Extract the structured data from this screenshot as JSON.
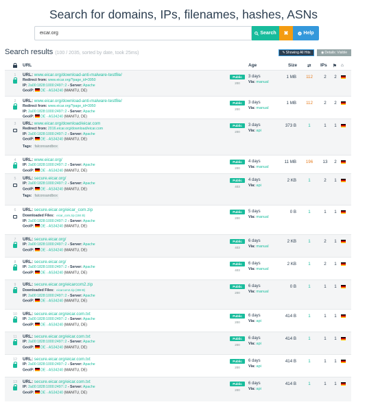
{
  "title": "Search for domains, IPs, filenames, hashes, ASNs",
  "search": {
    "value": "eicar.org",
    "search_label": "Search",
    "clear_label": "✖",
    "help_label": "Help"
  },
  "results": {
    "heading": "Search results",
    "meta": "(100 / 2035, sorted by date, took 25ms)",
    "show_hits_label": "Showing All Hits",
    "details_label": "Details: Visible"
  },
  "columns": {
    "url": "URL",
    "age": "Age",
    "size": "Size",
    "ips": "IPs"
  },
  "labels": {
    "url": "URL:",
    "redirect": "Redirect from:",
    "ip": "IP:",
    "server": "- Server:",
    "geoip": "GeoIP:",
    "tags": "Tags:",
    "downloaded": "Downloaded Files:",
    "via": "Via:"
  },
  "rows": [
    {
      "idx": "1",
      "lock": "green",
      "url": "www.eicar.org/download-anti-malware-testfile/",
      "redirect": "www.eicar.org/?page_id=3950",
      "ip": "2a00:1828:1000:2497::2",
      "server": "Apache",
      "geo": "DE - AS34240",
      "asn": "(MANITU, DE)",
      "status": "Public",
      "code": "200",
      "age": "3 days",
      "via": "manual",
      "size": "1 MB",
      "n1": "112",
      "n1_color": "orange",
      "n2": "2",
      "n3": "2"
    },
    {
      "idx": "2",
      "lock": "green",
      "url": "www.eicar.org/download-anti-malware-testfile/",
      "redirect": "www.eicar.org/?page_id=3950",
      "ip": "2a00:1828:1000:2497::2",
      "server": "Apache",
      "geo": "DE - AS34240",
      "asn": "(MANITU, DE)",
      "status": "Public",
      "code": "200",
      "age": "3 days",
      "via": "manual",
      "size": "1 MB",
      "n1": "112",
      "n1_color": "orange",
      "n2": "2",
      "n3": "2"
    },
    {
      "idx": "3",
      "lock": "grey",
      "url": "www.eicar.org/download/eicar.com",
      "redirect": "2016.eicar.org/download/eicar.com",
      "ip": "2a00:1828:1000:2497::2",
      "server": "Apache",
      "geo": "DE - AS34240",
      "asn": "(MANITU, DE)",
      "tags": "falconsandbox",
      "status": "Public",
      "code": "200",
      "age": "3 days",
      "via": "api",
      "size": "373 B",
      "n1": "1",
      "n1_color": "teal",
      "n2": "1",
      "n3": "1"
    },
    {
      "idx": "4",
      "lock": "green",
      "url": "www.eicar.org/",
      "ip": "2a00:1828:1000:2497::2",
      "server": "Apache",
      "geo": "DE - AS34240",
      "asn": "(MANITU, DE)",
      "status": "Public",
      "code": "200",
      "age": "4 days",
      "via": "manual",
      "size": "11 MB",
      "n1": "196",
      "n1_color": "orange",
      "n2": "13",
      "n3": "2"
    },
    {
      "idx": "5",
      "lock": "grey",
      "url": "secure.eicar.org/",
      "ip": "2a00:1828:1000:2497::2",
      "server": "Apache",
      "geo": "DE - AS34240",
      "asn": "(MANITU, DE)",
      "tags": "falconsandbox",
      "status": "Public",
      "code": "403",
      "age": "4 days",
      "via": "api",
      "size": "2 KB",
      "n1": "1",
      "n1_color": "teal",
      "n2": "2",
      "n3": "1"
    },
    {
      "idx": "6",
      "lock": "grey",
      "url": "secure.eicar.org/eicar_com.zip",
      "dl": "eicar_com.zip (184 B)",
      "ip": "2a00:1828:1000:2497::2",
      "server": "Apache",
      "geo": "DE - AS34240",
      "asn": "(MANITU, DE)",
      "status": "Public",
      "code": "200",
      "age": "5 days",
      "via": "manual",
      "size": "0 B",
      "n1": "1",
      "n1_color": "teal",
      "n2": "1",
      "n3": "1"
    },
    {
      "idx": "7",
      "lock": "green",
      "url": "secure.eicar.org/",
      "ip": "2a00:1828:1000:2497::2",
      "server": "Apache",
      "geo": "DE - AS34240",
      "asn": "(MANITU, DE)",
      "status": "Public",
      "code": "403",
      "age": "6 days",
      "via": "manual",
      "size": "2 KB",
      "n1": "1",
      "n1_color": "teal",
      "n2": "2",
      "n3": "1"
    },
    {
      "idx": "8",
      "lock": "green",
      "url": "secure.eicar.org/",
      "ip": "2a00:1828:1000:2497::2",
      "server": "Apache",
      "geo": "DE - AS34240",
      "asn": "(MANITU, DE)",
      "status": "Public",
      "code": "403",
      "age": "6 days",
      "via": "manual",
      "size": "2 KB",
      "n1": "1",
      "n1_color": "teal",
      "n2": "2",
      "n3": "1"
    },
    {
      "idx": "9",
      "lock": "green",
      "url": "secure.eicar.org/eicarcom2.zip",
      "dl": "eicarcom2.zip (308 B)",
      "ip": "2a00:1828:1000:2497::2",
      "server": "Apache",
      "geo": "DE - AS34240",
      "asn": "(MANITU, DE)",
      "status": "Public",
      "code": "200",
      "age": "6 days",
      "via": "manual",
      "size": "0 B",
      "n1": "1",
      "n1_color": "teal",
      "n2": "1",
      "n3": "1"
    },
    {
      "idx": "10",
      "lock": "green",
      "url": "secure.eicar.org/eicar.com.txt",
      "ip": "2a00:1828:1000:2497::2",
      "server": "Apache",
      "geo": "DE - AS34240",
      "asn": "(MANITU, DE)",
      "status": "Public",
      "code": "200",
      "age": "6 days",
      "via": "api",
      "size": "414 B",
      "n1": "1",
      "n1_color": "teal",
      "n2": "1",
      "n3": "1"
    },
    {
      "idx": "11",
      "lock": "green",
      "url": "secure.eicar.org/eicar.com.txt",
      "ip": "2a00:1828:1000:2497::2",
      "server": "Apache",
      "geo": "DE - AS34240",
      "asn": "(MANITU, DE)",
      "status": "Public",
      "code": "200",
      "age": "6 days",
      "via": "api",
      "size": "414 B",
      "n1": "1",
      "n1_color": "teal",
      "n2": "1",
      "n3": "1"
    },
    {
      "idx": "12",
      "lock": "green",
      "url": "secure.eicar.org/eicar.com.txt",
      "ip": "2a00:1828:1000:2497::2",
      "server": "Apache",
      "geo": "DE - AS34240",
      "asn": "(MANITU, DE)",
      "status": "Public",
      "code": "200",
      "age": "6 days",
      "via": "api",
      "size": "414 B",
      "n1": "1",
      "n1_color": "teal",
      "n2": "1",
      "n3": "1"
    },
    {
      "idx": "13",
      "lock": "green",
      "url": "secure.eicar.org/eicar.com.txt",
      "ip": "2a00:1828:1000:2497::2",
      "server": "Apache",
      "geo": "DE - AS34240",
      "asn": "(MANITU, DE)",
      "status": "Public",
      "code": "200",
      "age": "6 days",
      "via": "api",
      "size": "414 B",
      "n1": "1",
      "n1_color": "teal",
      "n2": "1",
      "n3": "1"
    }
  ]
}
